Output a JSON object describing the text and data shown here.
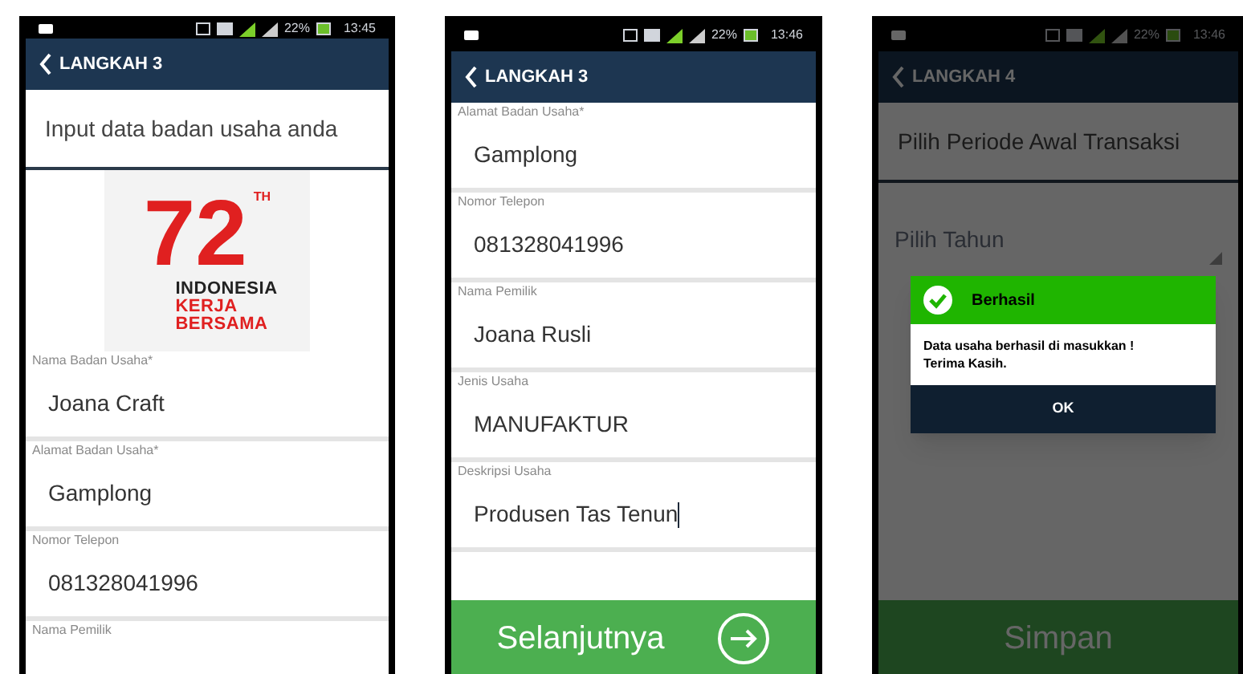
{
  "phones": [
    {
      "status_bar": {
        "battery": "22%",
        "time": "13:45"
      },
      "header": {
        "title": "LANGKAH 3"
      },
      "intro": "Input data badan usaha anda",
      "logo": {
        "number": "72",
        "superscript": "TH",
        "lines": [
          {
            "text": "INDONESIA",
            "color": "#222222"
          },
          {
            "text": "KERJA",
            "color": "#e02020"
          },
          {
            "text": "BERSAMA",
            "color": "#e02020"
          }
        ]
      },
      "fields": [
        {
          "kind": "input",
          "label": "Nama Badan Usaha*",
          "value": "Joana Craft",
          "focused": false
        },
        {
          "kind": "input",
          "label": "Alamat Badan Usaha*",
          "value": "Gamplong",
          "focused": false
        },
        {
          "kind": "input",
          "label": "Nomor Telepon",
          "value": "081328041996",
          "focused": false
        },
        {
          "kind": "input",
          "label": "Nama Pemilik"
        }
      ],
      "dimmed": false
    },
    {
      "status_bar": {
        "battery": "22%",
        "time": "13:46"
      },
      "header": {
        "title": "LANGKAH 3"
      },
      "fields": [
        {
          "kind": "input",
          "label": "Alamat Badan Usaha*",
          "value": "Gamplong",
          "focused": false
        },
        {
          "kind": "input",
          "label": "Nomor Telepon",
          "value": "081328041996",
          "focused": false
        },
        {
          "kind": "input",
          "label": "Nama Pemilik",
          "value": "Joana Rusli",
          "focused": false
        },
        {
          "kind": "input",
          "label": "Jenis Usaha",
          "value": "MANUFAKTUR",
          "focused": false
        },
        {
          "kind": "input",
          "label": "Deskripsi Usaha",
          "value": "Produsen Tas Tenun",
          "focused": true
        }
      ],
      "primary_button": {
        "label": "Selanjutnya",
        "arrow": true
      },
      "dimmed": false
    },
    {
      "status_bar": {
        "battery": "22%",
        "time": "13:46"
      },
      "header": {
        "title": "LANGKAH 4"
      },
      "intro": "Pilih Periode Awal Transaksi",
      "fields": [
        {
          "kind": "select",
          "placeholder": "Pilih Tahun"
        }
      ],
      "primary_button": {
        "label": "Simpan",
        "arrow": false
      },
      "dimmed": true,
      "dialog": {
        "title": "Berhasil",
        "message": "Data usaha berhasil di masukkan ! Terima Kasih.",
        "button": "OK"
      }
    }
  ]
}
